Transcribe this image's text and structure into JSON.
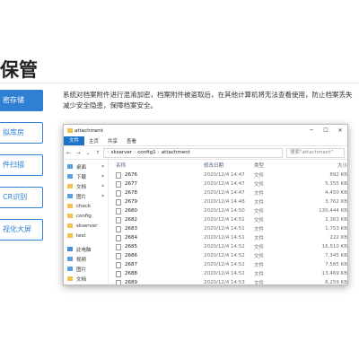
{
  "page": {
    "title": "保管"
  },
  "sidebar": {
    "items": [
      {
        "label": "密存储",
        "active": true
      },
      {
        "label": "拟库房",
        "active": false
      },
      {
        "label": "件扫描",
        "active": false
      },
      {
        "label": "CR识别",
        "active": false
      },
      {
        "label": "视化大屏",
        "active": false
      }
    ]
  },
  "description": {
    "line1": "系统对档案附件进行混淆加密，档案附件被盗取后，在其他计算机将无法查看使用，防止档案丢失",
    "line2": "减少安全隐患，保障档案安全。"
  },
  "explorer": {
    "window_title": "attachment",
    "ribbon": {
      "file_tab": "文件",
      "tabs": [
        "主页",
        "共享",
        "查看"
      ]
    },
    "address": [
      "skserver",
      "config1",
      "attachment"
    ],
    "search_placeholder": "搜索\"attachment\"",
    "nav": [
      {
        "label": "桌面",
        "icon": "desktop-icon",
        "pinned": true
      },
      {
        "label": "下载",
        "icon": "download-icon",
        "pinned": true
      },
      {
        "label": "文档",
        "icon": "documents-icon",
        "pinned": true
      },
      {
        "label": "图片",
        "icon": "pictures-icon",
        "pinned": true
      },
      {
        "label": "check",
        "icon": "folder-icon",
        "pinned": false
      },
      {
        "label": "config",
        "icon": "folder-icon",
        "pinned": false
      },
      {
        "label": "skserver",
        "icon": "folder-icon",
        "pinned": false
      },
      {
        "label": "test",
        "icon": "folder-icon",
        "pinned": false
      },
      {
        "label": "此电脑",
        "icon": "computer-icon",
        "pinned": false
      },
      {
        "label": "视频",
        "icon": "videos-icon",
        "pinned": false
      },
      {
        "label": "图片",
        "icon": "pictures-icon",
        "pinned": false
      },
      {
        "label": "文档",
        "icon": "documents-icon",
        "pinned": false
      }
    ],
    "columns": {
      "name": "名称",
      "date": "修改日期",
      "type": "类型",
      "size": "大小"
    },
    "rows": [
      {
        "name": "2676",
        "date": "2020/12/4 14:47",
        "type": "文件",
        "size": "892 KB"
      },
      {
        "name": "2677",
        "date": "2020/12/4 14:47",
        "type": "文件",
        "size": "5,355 KB"
      },
      {
        "name": "2678",
        "date": "2020/12/4 14:47",
        "type": "文件",
        "size": "4,450 KB"
      },
      {
        "name": "2679",
        "date": "2020/12/4 14:48",
        "type": "文件",
        "size": "3,762 KB"
      },
      {
        "name": "2680",
        "date": "2020/12/4 14:50",
        "type": "文件",
        "size": "130,444 KB"
      },
      {
        "name": "2682",
        "date": "2020/12/4 14:51",
        "type": "文件",
        "size": "2,363 KB"
      },
      {
        "name": "2683",
        "date": "2020/12/4 14:51",
        "type": "文件",
        "size": "1,753 KB"
      },
      {
        "name": "2684",
        "date": "2020/12/4 14:51",
        "type": "文件",
        "size": "222 KB"
      },
      {
        "name": "2685",
        "date": "2020/12/4 14:52",
        "type": "文件",
        "size": "16,510 KB"
      },
      {
        "name": "2686",
        "date": "2020/12/4 14:52",
        "type": "文件",
        "size": "7,345 KB"
      },
      {
        "name": "2687",
        "date": "2020/12/4 14:52",
        "type": "文件",
        "size": "7,585 KB"
      },
      {
        "name": "2688",
        "date": "2020/12/4 14:52",
        "type": "文件",
        "size": "13,469 KB"
      },
      {
        "name": "2689",
        "date": "2020/12/4 14:53",
        "type": "文件",
        "size": "6,259 KB"
      }
    ]
  },
  "colors": {
    "accent": "#2f7fd4",
    "ribbon_file": "#1a73c9",
    "folder": "#f2c14e"
  }
}
